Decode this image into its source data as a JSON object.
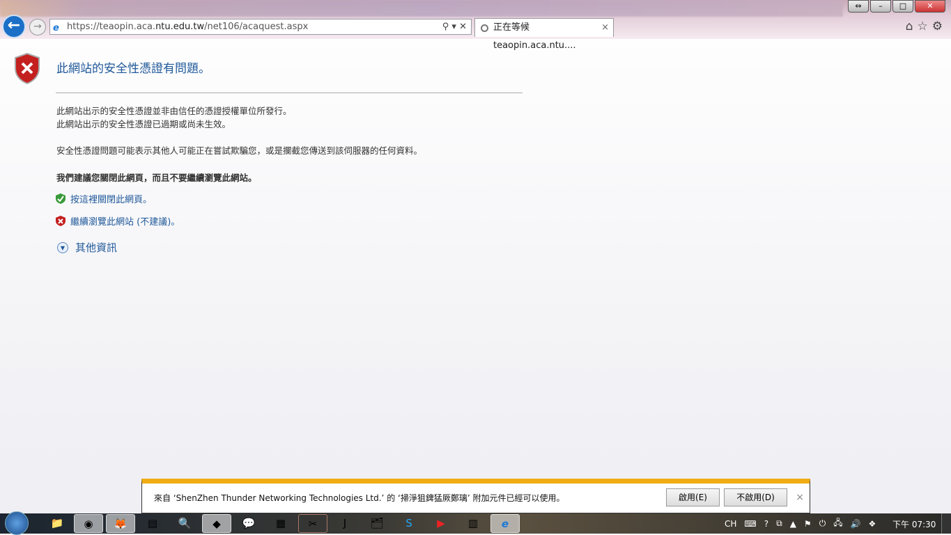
{
  "browser": {
    "url_prefix": "https://teaopin.aca.",
    "url_domain": "ntu.edu.tw",
    "url_path": "/net106/acaquest.aspx",
    "tab_title": "正在等候 teaopin.aca.ntu....",
    "address_controls": "⚲ ▾ ✕"
  },
  "page": {
    "title": "此網站的安全性憑證有問題。",
    "line1": "此網站出示的安全性憑證並非由信任的憑證授權單位所發行。",
    "line2": "此網站出示的安全性憑證已過期或尚未生效。",
    "line3": "安全性憑證問題可能表示其他人可能正在嘗試欺騙您，或是攔截您傳送到該伺服器的任何資料。",
    "recommend": "我們建議您關閉此網頁，而且不要繼續瀏覽此網站。",
    "close_link": "按這裡關閉此網頁。",
    "continue_link": "繼續瀏覽此網站 (不建議)。",
    "more_info": "其他資訊"
  },
  "notification": {
    "message": "來自 ‘ShenZhen Thunder Networking Technologies Ltd.’ 的 ‘掃淨狙錍猛厥鄭璃’ 附加元件已經可以使用。",
    "enable": "啟用(E)",
    "disable": "不啟用(D)",
    "close": "×",
    "accent": "#f0ac14"
  },
  "taskbar": {
    "lang": "CH",
    "clock": "下午 07:30"
  }
}
